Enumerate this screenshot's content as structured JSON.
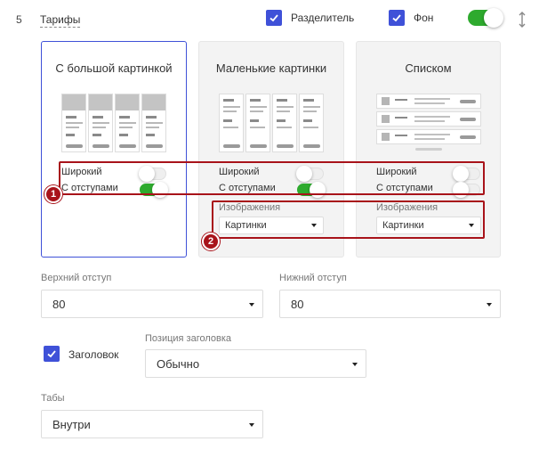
{
  "header": {
    "row_number": "5",
    "section_title": "Тарифы",
    "divider_label": "Разделитель",
    "background_label": "Фон"
  },
  "cards": [
    {
      "title": "С большой картинкой",
      "preview": "columns-large",
      "wide_label": "Широкий",
      "wide_on": false,
      "padding_label": "С отступами",
      "padding_on": true,
      "selected": true
    },
    {
      "title": "Маленькие картинки",
      "preview": "columns-small",
      "wide_label": "Широкий",
      "wide_on": false,
      "padding_label": "С отступами",
      "padding_on": true,
      "images_label": "Изображения",
      "images_value": "Картинки"
    },
    {
      "title": "Списком",
      "preview": "list",
      "wide_label": "Широкий",
      "wide_on": false,
      "padding_label": "С отступами",
      "padding_on": false,
      "images_label": "Изображения",
      "images_value": "Картинки"
    }
  ],
  "annotations": [
    "1",
    "2"
  ],
  "form": {
    "top_padding_label": "Верхний отступ",
    "top_padding_value": "80",
    "bottom_padding_label": "Нижний отступ",
    "bottom_padding_value": "80",
    "heading_label": "Заголовок",
    "heading_position_label": "Позиция заголовка",
    "heading_position_value": "Обычно",
    "tabs_label": "Табы",
    "tabs_value": "Внутри"
  },
  "colors": {
    "accent": "#3f51d8",
    "toggle_on": "#2eaa2e",
    "annotation": "#a8131a"
  },
  "icons": [
    "check-icon",
    "resize-vertical-icon",
    "caret-down-icon"
  ]
}
